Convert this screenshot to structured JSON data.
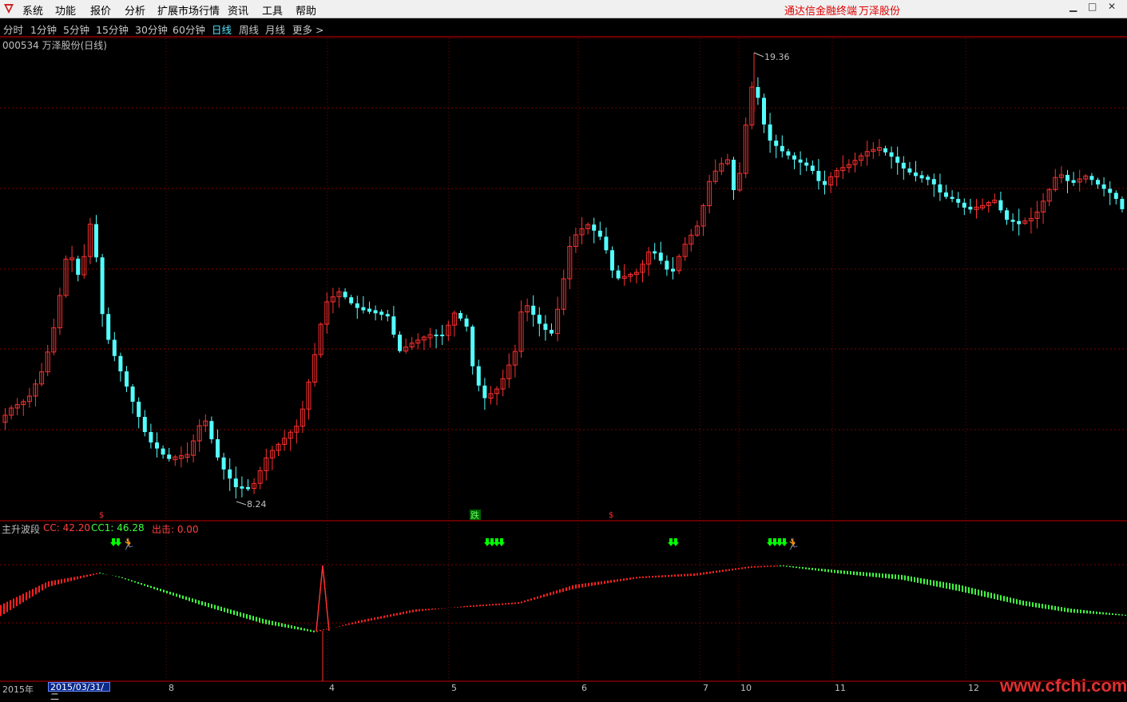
{
  "menu": [
    "系统",
    "功能",
    "报价",
    "分析",
    "扩展市场行情",
    "资讯",
    "工具",
    "帮助"
  ],
  "brand": {
    "app": "通达信金融终端",
    "stock": "万泽股份"
  },
  "periods": [
    "分时",
    "1分钟",
    "5分钟",
    "15分钟",
    "30分钟",
    "60分钟",
    "日线",
    "周线",
    "月线",
    "更多 >"
  ],
  "active_period": "日线",
  "chart_title": "000534 万泽股份(日线)",
  "price_annotations": {
    "high": "19.36",
    "low": "8.24"
  },
  "signals": {
    "sell_marker": "$",
    "fall_marker": "跌"
  },
  "indicator": {
    "name": "主升波段",
    "cc": "CC: 42.20",
    "cc1": "CC1: 46.28",
    "exit": "出击: 0.00"
  },
  "axis": {
    "year": "2015年",
    "cursor_date": "2015/03/31/二",
    "months": [
      "8",
      "4",
      "5",
      "6",
      "7",
      "10",
      "11",
      "12"
    ]
  },
  "watermark": "www.cfchi.com",
  "colors": {
    "up": "#ff3030",
    "down": "#54ffff",
    "grid": "#800000",
    "green": "#00ff00"
  },
  "chart_data": {
    "type": "candlestick",
    "price_range": [
      8.24,
      19.36
    ],
    "high_label": 19.36,
    "low_label": 8.24,
    "indicator_series": [
      {
        "name": "CC",
        "last": 42.2
      },
      {
        "name": "CC1",
        "last": 46.28
      },
      {
        "name": "出击",
        "last": 0.0
      }
    ]
  }
}
